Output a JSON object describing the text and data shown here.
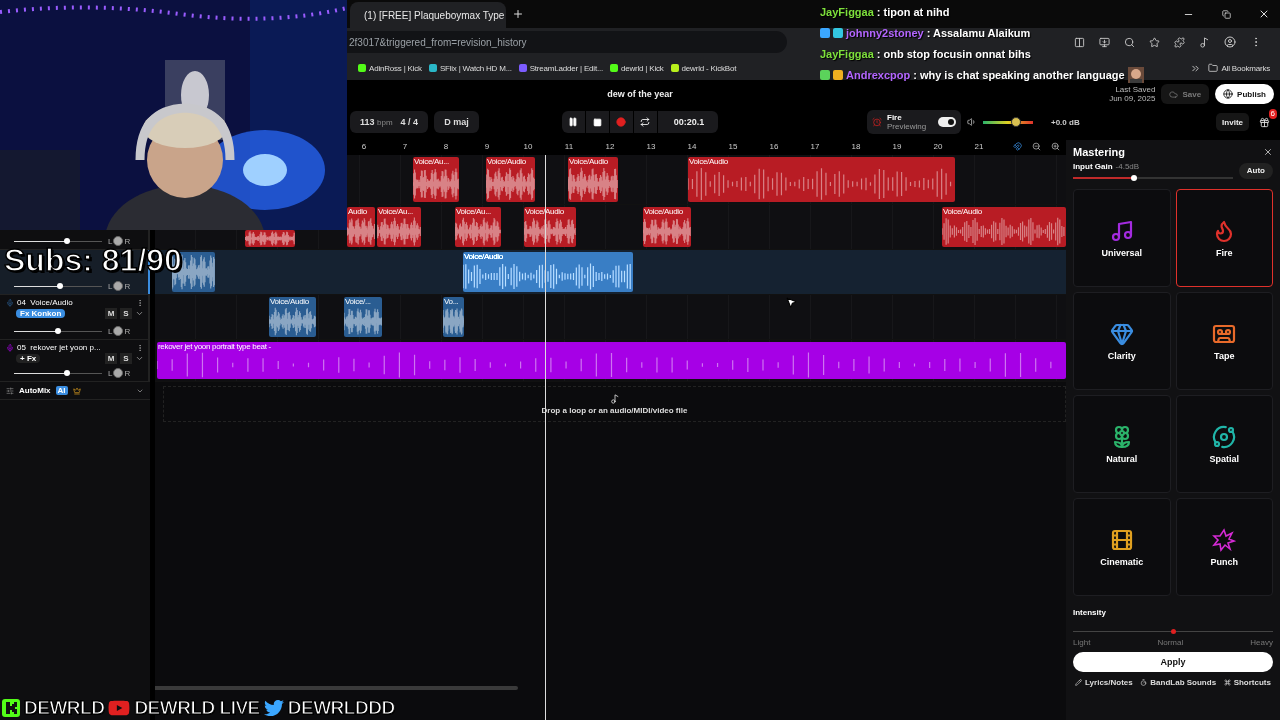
{
  "browser": {
    "tabs": [
      {
        "title": "(1) [FREE] Plaqueboymax Type",
        "selected": true
      }
    ],
    "address": "2f3017&triggered_from=revision_history",
    "bookmarks": [
      {
        "label": "AdinRoss | Kick",
        "color": "#53fc18"
      },
      {
        "label": "SFlix | Watch HD M...",
        "color": "#2ab7c8"
      },
      {
        "label": "StreamLadder | Edit...",
        "color": "#7c5cff"
      },
      {
        "label": "dewrld | Kick",
        "color": "#53fc18"
      },
      {
        "label": "dewrld - KickBot",
        "color": "#b8f01c"
      }
    ],
    "all_bookmarks": "All Bookmarks"
  },
  "chat": [
    {
      "user": "JayFiggaa",
      "message": ": tipon at nihd",
      "color": "#7ee03c",
      "emote": false
    },
    {
      "user": "johnny2stoney",
      "message": ": Assalamu Alaikum",
      "color": "#b466ff",
      "badges": [
        {
          "color": "#3ba7ff"
        },
        {
          "color": "#33c7e0"
        }
      ],
      "emote": false
    },
    {
      "user": "JayFiggaa",
      "message": ": onb stop focusin onnat bihs",
      "color": "#7ee03c",
      "emote": false
    },
    {
      "user": "Andrexcpop",
      "message": ": why is chat speaking another language",
      "color": "#b466ff",
      "badges": [
        {
          "color": "#5bd35b"
        },
        {
          "color": "#f0b020"
        }
      ],
      "emote": true
    }
  ],
  "daw": {
    "title": "dew of the year",
    "tempo": "113",
    "tempo_unit": "bpm",
    "time_signature": "4 / 4",
    "key": "D maj",
    "playing": true,
    "loop": false,
    "time": "00:20.1",
    "preview": {
      "label": "Fire",
      "sublabel": "Previewing",
      "on": true
    },
    "volume": {
      "level": 0.66,
      "reading": "+0.0 dB"
    },
    "last_saved_label": "Last Saved",
    "last_saved": "Jun 09, 2025",
    "save": {
      "label": "Save",
      "disabled": true
    },
    "publish": "Publish",
    "invite": "Invite",
    "gift_badge": "6"
  },
  "ruler": [
    "6",
    "7",
    "8",
    "9",
    "10",
    "11",
    "12",
    "13",
    "14",
    "15",
    "16",
    "17",
    "18",
    "19",
    "20",
    "21"
  ],
  "tracks": [
    {
      "kind": "hidden",
      "color": "#b81c24",
      "clips": [
        {
          "label": "Voice/Au...",
          "selected": false
        },
        {
          "label": "Voice/Audio",
          "selected": false
        },
        {
          "label": "Voice/Audio",
          "selected": false
        },
        {
          "label": "Voice/Audio",
          "selected": false
        }
      ]
    },
    {
      "kind": "covered",
      "selected": false,
      "color": "#b81c24",
      "level": 0.6,
      "pan_left": "L",
      "pan_right": "R",
      "clips": [
        {
          "selected": false
        },
        {
          "label": "Audio",
          "selected": false
        },
        {
          "label": "Voice/Au...",
          "selected": false
        },
        {
          "label": "Voice/Au...",
          "selected": false
        },
        {
          "label": "Voice/Audio",
          "selected": false
        },
        {
          "label": "Voice/Audio",
          "selected": false
        },
        {
          "label": "Voice/Audio",
          "selected": false
        }
      ]
    },
    {
      "kind": "covered",
      "selected": true,
      "color": "#2a5d92",
      "level": 0.52,
      "pan_left": "L",
      "pan_right": "R",
      "clips": [
        {
          "selected": false
        },
        {
          "label": "Voice/Audio",
          "selected": true
        }
      ]
    },
    {
      "kind": "full",
      "selected": false,
      "color": "#2a5d92",
      "number": "04",
      "name": "Voice/Audio",
      "fx": "Fx Konkon",
      "fx_active": true,
      "mute": "M",
      "solo": "S",
      "level": 0.5,
      "pan_left": "L",
      "pan_right": "R",
      "clips": [
        {
          "label": "Voice/Audio",
          "selected": false
        },
        {
          "label": "Voice/...",
          "selected": false
        },
        {
          "label": "Vo...",
          "selected": false
        }
      ]
    },
    {
      "kind": "full",
      "selected": false,
      "color": "#a600e6",
      "number": "05",
      "name": "rekover jet yoon p...",
      "fx": "+ Fx",
      "fx_active": false,
      "mute": "M",
      "solo": "S",
      "level": 0.6,
      "pan_left": "L",
      "pan_right": "R",
      "clips": [
        {
          "label": "rekover jet  yoon  portrait type beat -",
          "selected": false
        }
      ]
    }
  ],
  "automix": {
    "label": "AutoMix",
    "badge": "AI"
  },
  "drop_zone": "Drop a loop or an audio/MIDI/video file",
  "mastering": {
    "title": "Mastering",
    "input_gain": {
      "label": "Input Gain",
      "reading": "-4.5dB",
      "level": 0.38
    },
    "auto": "Auto",
    "presets": [
      {
        "label": "Universal",
        "color": "#a42be0",
        "selected": false
      },
      {
        "label": "Fire",
        "color": "#e0312b",
        "selected": true
      },
      {
        "label": "Clarity",
        "color": "#3a8de0",
        "selected": false
      },
      {
        "label": "Tape",
        "color": "#e86a2a",
        "selected": false
      },
      {
        "label": "Natural",
        "color": "#2bb36a",
        "selected": false
      },
      {
        "label": "Spatial",
        "color": "#20b5a8",
        "selected": false
      },
      {
        "label": "Cinematic",
        "color": "#e0a020",
        "selected": false
      },
      {
        "label": "Punch",
        "color": "#d42ad4",
        "selected": false
      }
    ],
    "intensity": {
      "label": "Intensity",
      "level": 0.5,
      "marks": [
        "Light",
        "Normal",
        "Heavy"
      ]
    },
    "apply": "Apply",
    "footer": [
      "Lyrics/Notes",
      "BandLab Sounds",
      "Shortcuts"
    ]
  },
  "overlay": {
    "subs": "Subs: 81/90",
    "socials": [
      {
        "kind": "kick",
        "handle": "DEWRLD"
      },
      {
        "kind": "youtube",
        "handle": "DEWRLD LIVE"
      },
      {
        "kind": "twitter",
        "handle": "DEWRLDDD"
      }
    ]
  }
}
